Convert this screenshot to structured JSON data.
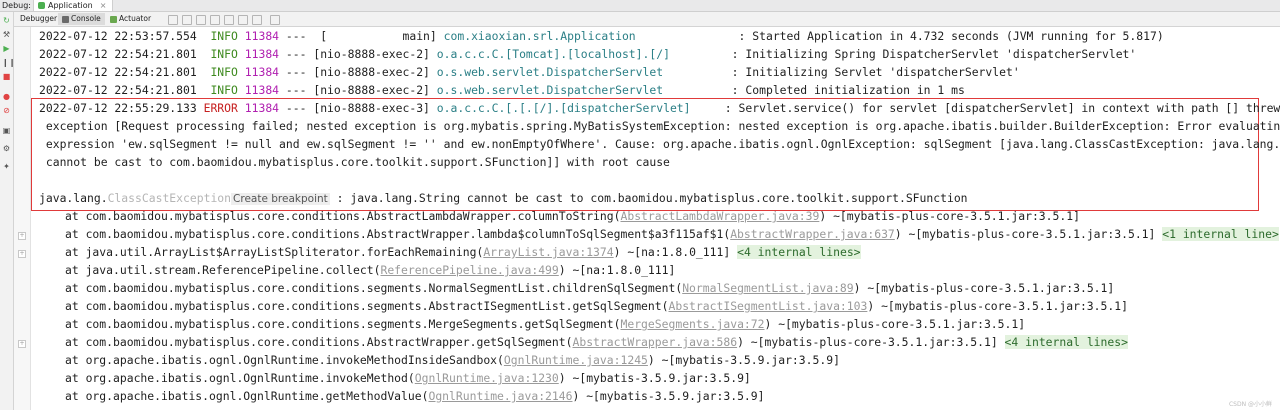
{
  "topbar": {
    "debug_label": "Debug:",
    "app_tab_label": "Application",
    "close_glyph": "×"
  },
  "toolbar": {
    "tabs": [
      {
        "label": "Debugger"
      },
      {
        "label": "Console"
      },
      {
        "label": "Actuator"
      }
    ]
  },
  "log_lines": [
    {
      "ts": "2022-07-12 22:53:57.554",
      "lvl": "INFO",
      "pid": "11384",
      "thread": "---  [           main] ",
      "logger": "com.xiaoxian.srl.Application             ",
      "msg": "  : Started Application in 4.732 seconds (JVM running for 5.817)"
    },
    {
      "ts": "2022-07-12 22:54:21.801",
      "lvl": "INFO",
      "pid": "11384",
      "thread": "--- [nio-8888-exec-2] ",
      "logger": "o.a.c.c.C.[Tomcat].[localhost].[/]       ",
      "msg": "  : Initializing Spring DispatcherServlet 'dispatcherServlet'"
    },
    {
      "ts": "2022-07-12 22:54:21.801",
      "lvl": "INFO",
      "pid": "11384",
      "thread": "--- [nio-8888-exec-2] ",
      "logger": "o.s.web.servlet.DispatcherServlet        ",
      "msg": "  : Initializing Servlet 'dispatcherServlet'"
    },
    {
      "ts": "2022-07-12 22:54:21.801",
      "lvl": "INFO",
      "pid": "11384",
      "thread": "--- [nio-8888-exec-2] ",
      "logger": "o.s.web.servlet.DispatcherServlet        ",
      "msg": "  : Completed initialization in 1 ms"
    },
    {
      "ts": "2022-07-12 22:55:29.133",
      "lvl": "ERROR",
      "pid": "11384",
      "thread": "--- [nio-8888-exec-3] ",
      "logger": "o.a.c.c.C.[.[.[/].[dispatcherServlet]    ",
      "msg": " : Servlet.service() for servlet [dispatcherServlet] in context with path [] threw"
    }
  ],
  "error_continuation": [
    " exception [Request processing failed; nested exception is org.mybatis.spring.MyBatisSystemException: nested exception is org.apache.ibatis.builder.BuilderException: Error evaluating",
    " expression 'ew.sqlSegment != null and ew.sqlSegment != '' and ew.nonEmptyOfWhere'. Cause: org.apache.ibatis.ognl.OgnlException: sqlSegment [java.lang.ClassCastException: java.lang.String",
    " cannot be cast to com.baomidou.mybatisplus.core.toolkit.support.SFunction]] with root cause"
  ],
  "exception_line": {
    "prefix": "java.lang.",
    "class_name": "ClassCastException",
    "breakpoint_label": "Create breakpoint",
    "message": " : java.lang.String cannot be cast to com.baomidou.mybatisplus.core.toolkit.support.SFunction"
  },
  "stack": [
    {
      "method": "at com.baomidou.mybatisplus.core.conditions.AbstractLambdaWrapper.columnToString(",
      "link": "AbstractLambdaWrapper.java:39",
      "suffix": ") ~[mybatis-plus-core-3.5.1.jar:3.5.1]",
      "chip": ""
    },
    {
      "method": "at com.baomidou.mybatisplus.core.conditions.AbstractWrapper.lambda$columnToSqlSegment$a3f115af$1(",
      "link": "AbstractWrapper.java:637",
      "suffix": ") ~[mybatis-plus-core-3.5.1.jar:3.5.1] ",
      "chip": "<1 internal line>"
    },
    {
      "method": "at java.util.ArrayList$ArrayListSpliterator.forEachRemaining(",
      "link": "ArrayList.java:1374",
      "suffix": ") ~[na:1.8.0_111] ",
      "chip": "<4 internal lines>"
    },
    {
      "method": "at java.util.stream.ReferencePipeline.collect(",
      "link": "ReferencePipeline.java:499",
      "suffix": ") ~[na:1.8.0_111]",
      "chip": ""
    },
    {
      "method": "at com.baomidou.mybatisplus.core.conditions.segments.NormalSegmentList.childrenSqlSegment(",
      "link": "NormalSegmentList.java:89",
      "suffix": ") ~[mybatis-plus-core-3.5.1.jar:3.5.1]",
      "chip": ""
    },
    {
      "method": "at com.baomidou.mybatisplus.core.conditions.segments.AbstractISegmentList.getSqlSegment(",
      "link": "AbstractISegmentList.java:103",
      "suffix": ") ~[mybatis-plus-core-3.5.1.jar:3.5.1]",
      "chip": ""
    },
    {
      "method": "at com.baomidou.mybatisplus.core.conditions.segments.MergeSegments.getSqlSegment(",
      "link": "MergeSegments.java:72",
      "suffix": ") ~[mybatis-plus-core-3.5.1.jar:3.5.1]",
      "chip": ""
    },
    {
      "method": "at com.baomidou.mybatisplus.core.conditions.AbstractWrapper.getSqlSegment(",
      "link": "AbstractWrapper.java:586",
      "suffix": ") ~[mybatis-plus-core-3.5.1.jar:3.5.1] ",
      "chip": "<4 internal lines>"
    },
    {
      "method": "at org.apache.ibatis.ognl.OgnlRuntime.invokeMethodInsideSandbox(",
      "link": "OgnlRuntime.java:1245",
      "suffix": ") ~[mybatis-3.5.9.jar:3.5.9]",
      "chip": ""
    },
    {
      "method": "at org.apache.ibatis.ognl.OgnlRuntime.invokeMethod(",
      "link": "OgnlRuntime.java:1230",
      "suffix": ") ~[mybatis-3.5.9.jar:3.5.9]",
      "chip": ""
    },
    {
      "method": "at org.apache.ibatis.ognl.OgnlRuntime.getMethodValue(",
      "link": "OgnlRuntime.java:2146",
      "suffix": ") ~[mybatis-3.5.9.jar:3.5.9]",
      "chip": ""
    }
  ],
  "watermark": "CSDN @小小鲜",
  "colors": {
    "info": "#3e8a1f",
    "error": "#c62020",
    "pid": "#b01fb0",
    "logger": "#2b7f86",
    "error_box": "#e03a3a",
    "chip_bg": "#e3f2de"
  },
  "icons": {
    "left_toolbar": [
      "rerun-icon",
      "wrench-icon",
      "resume-icon",
      "pause-icon",
      "stop-icon",
      "view-breakpoints-icon",
      "mute-breakpoints-icon",
      "camera-icon",
      "settings-icon",
      "pin-icon"
    ],
    "console_toolbar": [
      "step-over-icon",
      "step-into-icon",
      "force-step-into-icon",
      "step-out-icon",
      "drop-frame-icon",
      "run-to-cursor-icon",
      "evaluate-icon",
      "trace-icon",
      "table-icon"
    ]
  }
}
